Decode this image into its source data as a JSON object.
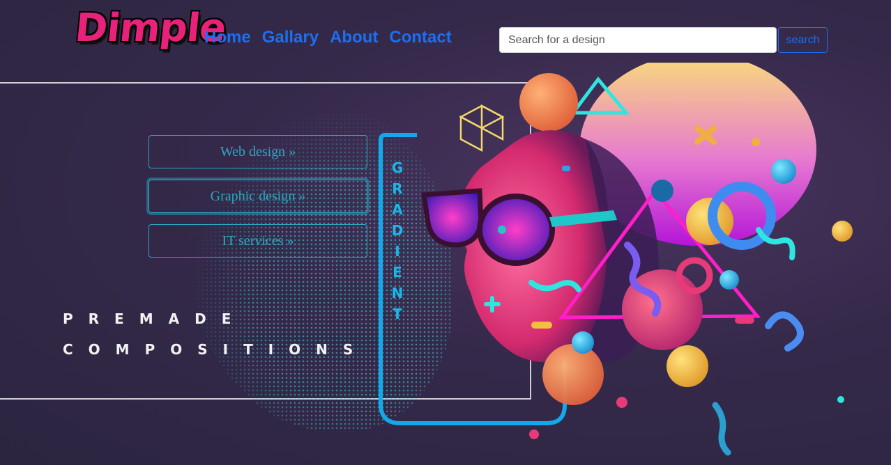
{
  "header": {
    "logo": "Dimple",
    "nav": [
      "Home",
      "Gallary",
      "About",
      "Contact"
    ],
    "search": {
      "placeholder": "Search for a design",
      "button": "search"
    }
  },
  "services": [
    "Web design »",
    "Graphic design »",
    "IT services »"
  ],
  "tagline": [
    "PREMADE",
    "COMPOSITIONS"
  ],
  "art": {
    "vertical_text": "GRADIENT"
  },
  "colors": {
    "logo": "#e8227a",
    "nav": "#1a6ff5",
    "accent": "#2aa8c0",
    "cyan": "#19b8ea",
    "magenta": "#ff1ec8"
  }
}
